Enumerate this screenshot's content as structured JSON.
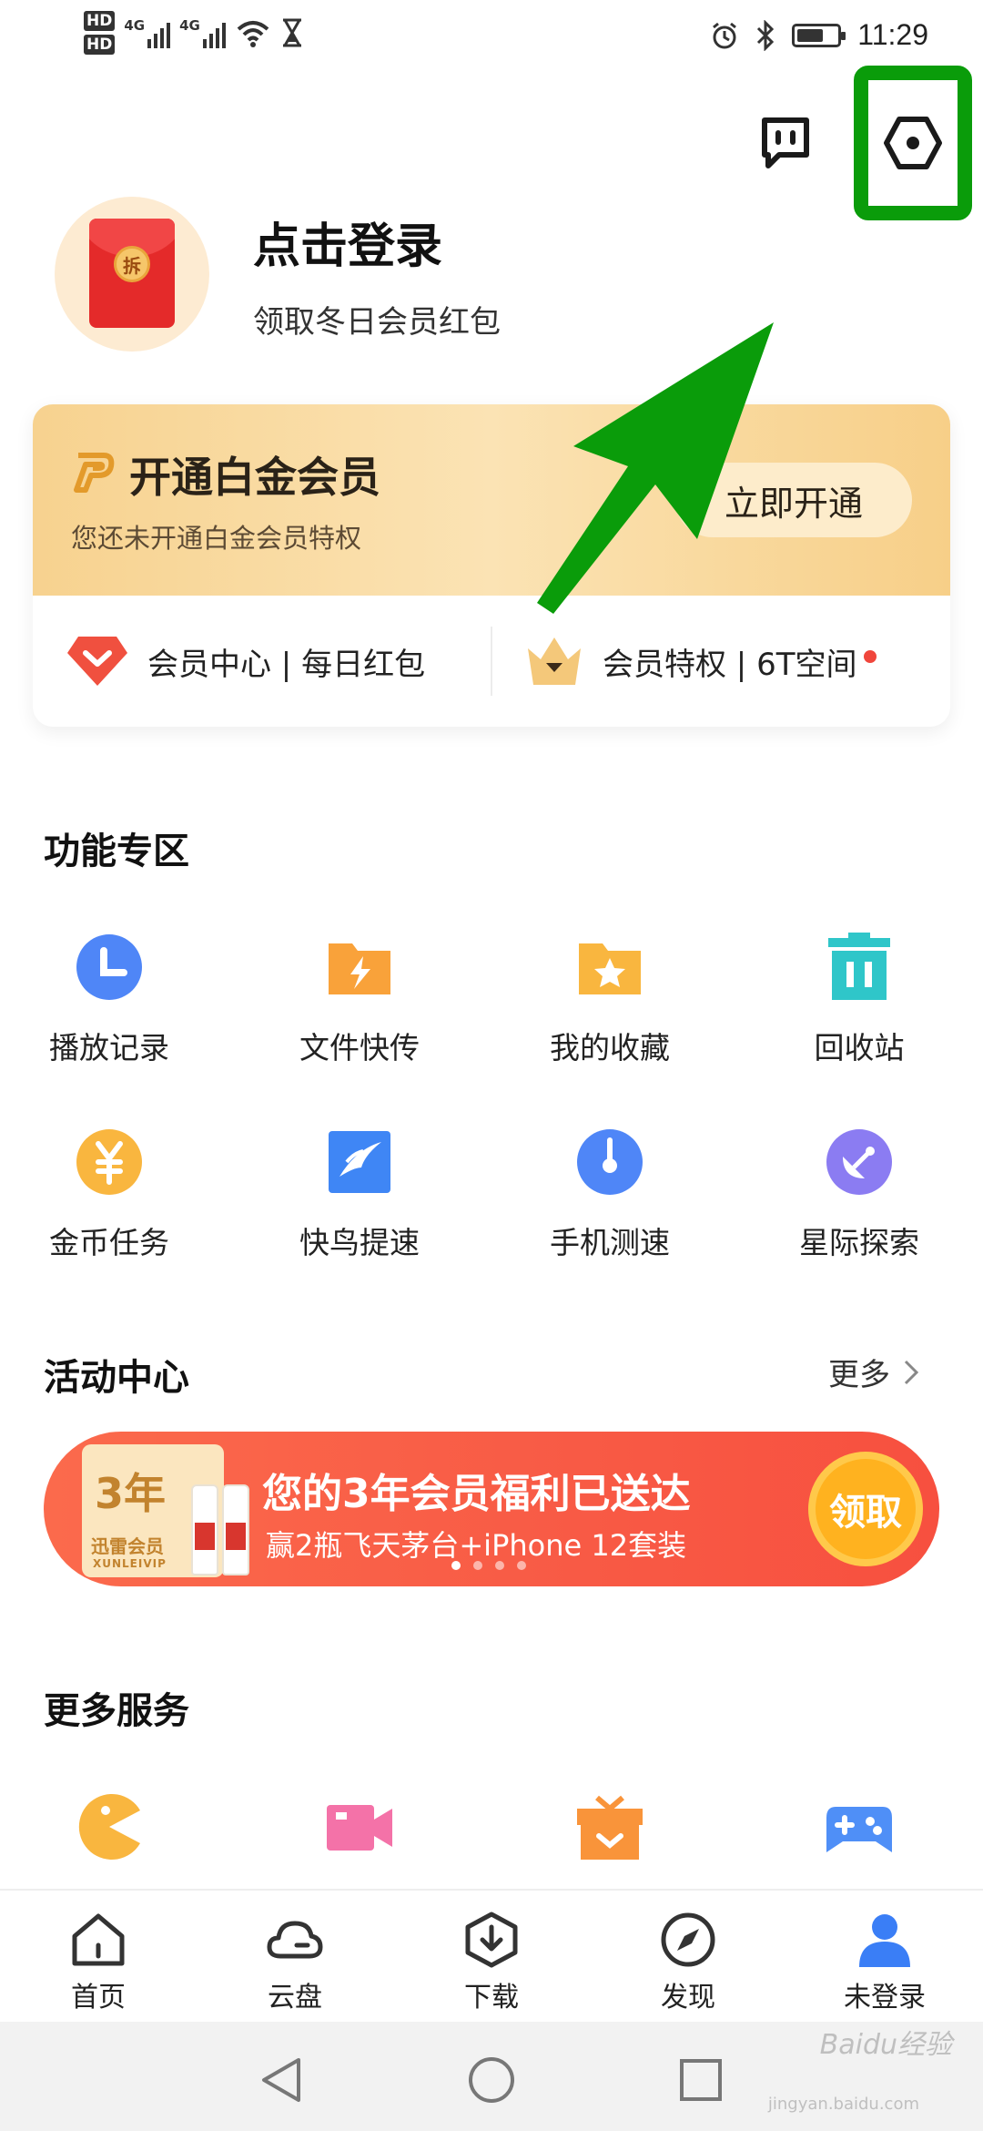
{
  "status_bar": {
    "sim1": "HD",
    "sim2": "HD",
    "network1": "4G",
    "network2": "4G",
    "time": "11:29"
  },
  "header": {
    "message_icon": "message-icon",
    "settings_icon": "settings-hexagon-icon",
    "highlight_color": "#0a9c0a"
  },
  "profile": {
    "login_title": "点击登录",
    "login_subtitle": "领取冬日会员红包",
    "envelope_seal": "拆"
  },
  "vip": {
    "title": "开通白金会员",
    "subtitle": "您还未开通白金会员特权",
    "open_button": "立即开通",
    "link1": "会员中心 | 每日红包",
    "link2": "会员特权 | 6T空间"
  },
  "features": {
    "section_title": "功能专区",
    "items": [
      {
        "label": "播放记录",
        "icon": "clock-icon",
        "color": "#4f86f7"
      },
      {
        "label": "文件快传",
        "icon": "lightning-folder-icon",
        "color": "#f9a23a"
      },
      {
        "label": "我的收藏",
        "icon": "star-folder-icon",
        "color": "#f9b63f"
      },
      {
        "label": "回收站",
        "icon": "trash-icon",
        "color": "#2fc6c9"
      },
      {
        "label": "金币任务",
        "icon": "yuan-coin-icon",
        "color": "#f9b63f"
      },
      {
        "label": "快鸟提速",
        "icon": "bird-icon",
        "color": "#3f86f5"
      },
      {
        "label": "手机测速",
        "icon": "speed-gauge-icon",
        "color": "#4f86f7"
      },
      {
        "label": "星际探索",
        "icon": "satellite-icon",
        "color": "#8b7cf2"
      }
    ]
  },
  "activity": {
    "section_title": "活动中心",
    "more": "更多",
    "banner": {
      "badge_year": "3年",
      "badge_name": "迅雷会员",
      "badge_en": "XUNLEIVIP",
      "title": "您的3年会员福利已送达",
      "subtitle": "赢2瓶飞天茅台+iPhone 12套装",
      "button": "领取",
      "slides": 4,
      "active_slide": 1
    }
  },
  "more_services": {
    "section_title": "更多服务",
    "items": [
      {
        "icon": "pacman-icon",
        "color": "#f9b63f"
      },
      {
        "icon": "video-camera-icon",
        "color": "#f472a8"
      },
      {
        "icon": "gift-box-icon",
        "color": "#f9943a"
      },
      {
        "icon": "gamepad-icon",
        "color": "#4f8ff7"
      }
    ]
  },
  "bottom_nav": [
    {
      "label": "首页",
      "icon": "home-icon"
    },
    {
      "label": "云盘",
      "icon": "cloud-icon"
    },
    {
      "label": "下载",
      "icon": "download-icon"
    },
    {
      "label": "发现",
      "icon": "compass-icon"
    },
    {
      "label": "未登录",
      "icon": "user-icon",
      "active_color": "#3a7ef6"
    }
  ],
  "system_nav": {
    "back_icon": "back-triangle-icon",
    "home_icon": "home-circle-icon",
    "recents_icon": "recents-square-icon"
  },
  "watermark": {
    "text": "Baidu经验",
    "sub": "jingyan.baidu.com"
  }
}
